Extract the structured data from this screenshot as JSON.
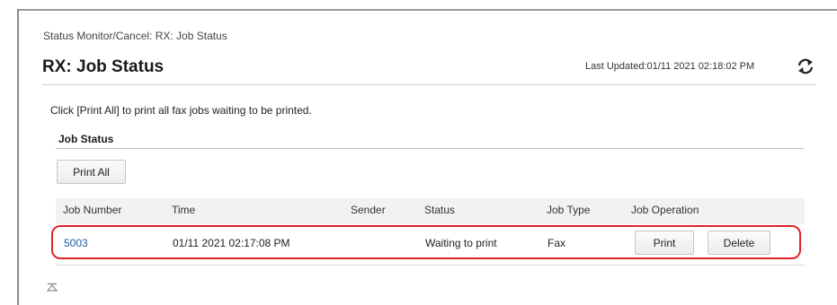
{
  "breadcrumb": "Status Monitor/Cancel: RX: Job Status",
  "page_title": "RX: Job Status",
  "last_updated": "Last Updated:01/11 2021 02:18:02 PM",
  "icons": {
    "refresh": "refresh-icon",
    "scroll_top": "scroll-to-top-icon"
  },
  "instruction": "Click [Print All] to print all fax jobs waiting to be printed.",
  "section_heading": "Job Status",
  "print_all_label": "Print All",
  "table": {
    "headers": [
      "Job Number",
      "Time",
      "Sender",
      "Status",
      "Job Type",
      "Job Operation"
    ],
    "rows": [
      {
        "job_number": "5003",
        "time": "01/11 2021 02:17:08 PM",
        "sender": "",
        "status": "Waiting to print",
        "job_type": "Fax",
        "print_label": "Print",
        "delete_label": "Delete"
      }
    ]
  },
  "colors": {
    "highlight": "#e0242a",
    "link": "#1d5fa8"
  }
}
